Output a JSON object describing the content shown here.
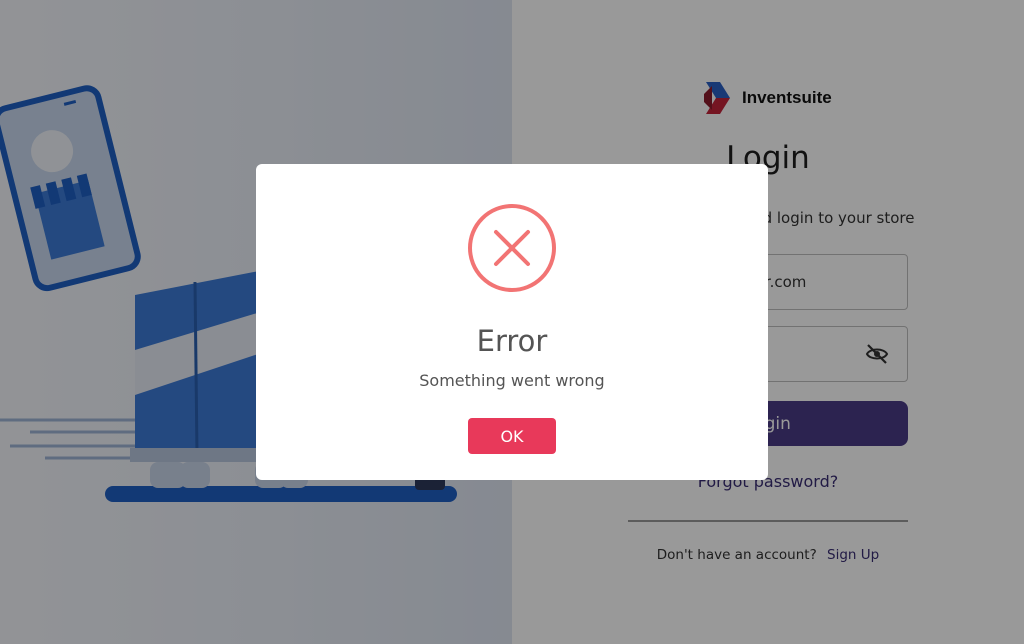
{
  "brand": {
    "name": "Inventsuite",
    "logo_icon": "inventsuite-logo-icon"
  },
  "login": {
    "title": "Login",
    "subtitle": "Email and password login to your store",
    "email_value": "user@mailinator.com",
    "password_value": "",
    "password_toggle_icon": "eye-off-icon",
    "login_button": "Login",
    "forgot_password": "Forgot password?",
    "no_account_text": "Don't have an account?",
    "signup_link": "Sign Up"
  },
  "modal": {
    "icon": "error-x-icon",
    "title": "Error",
    "message": "Something went wrong",
    "ok_button": "OK"
  },
  "colors": {
    "primary": "#4a3b86",
    "error": "#f27474",
    "ok_button": "#e8395a",
    "illustration_blue": "#1f5fc4"
  }
}
